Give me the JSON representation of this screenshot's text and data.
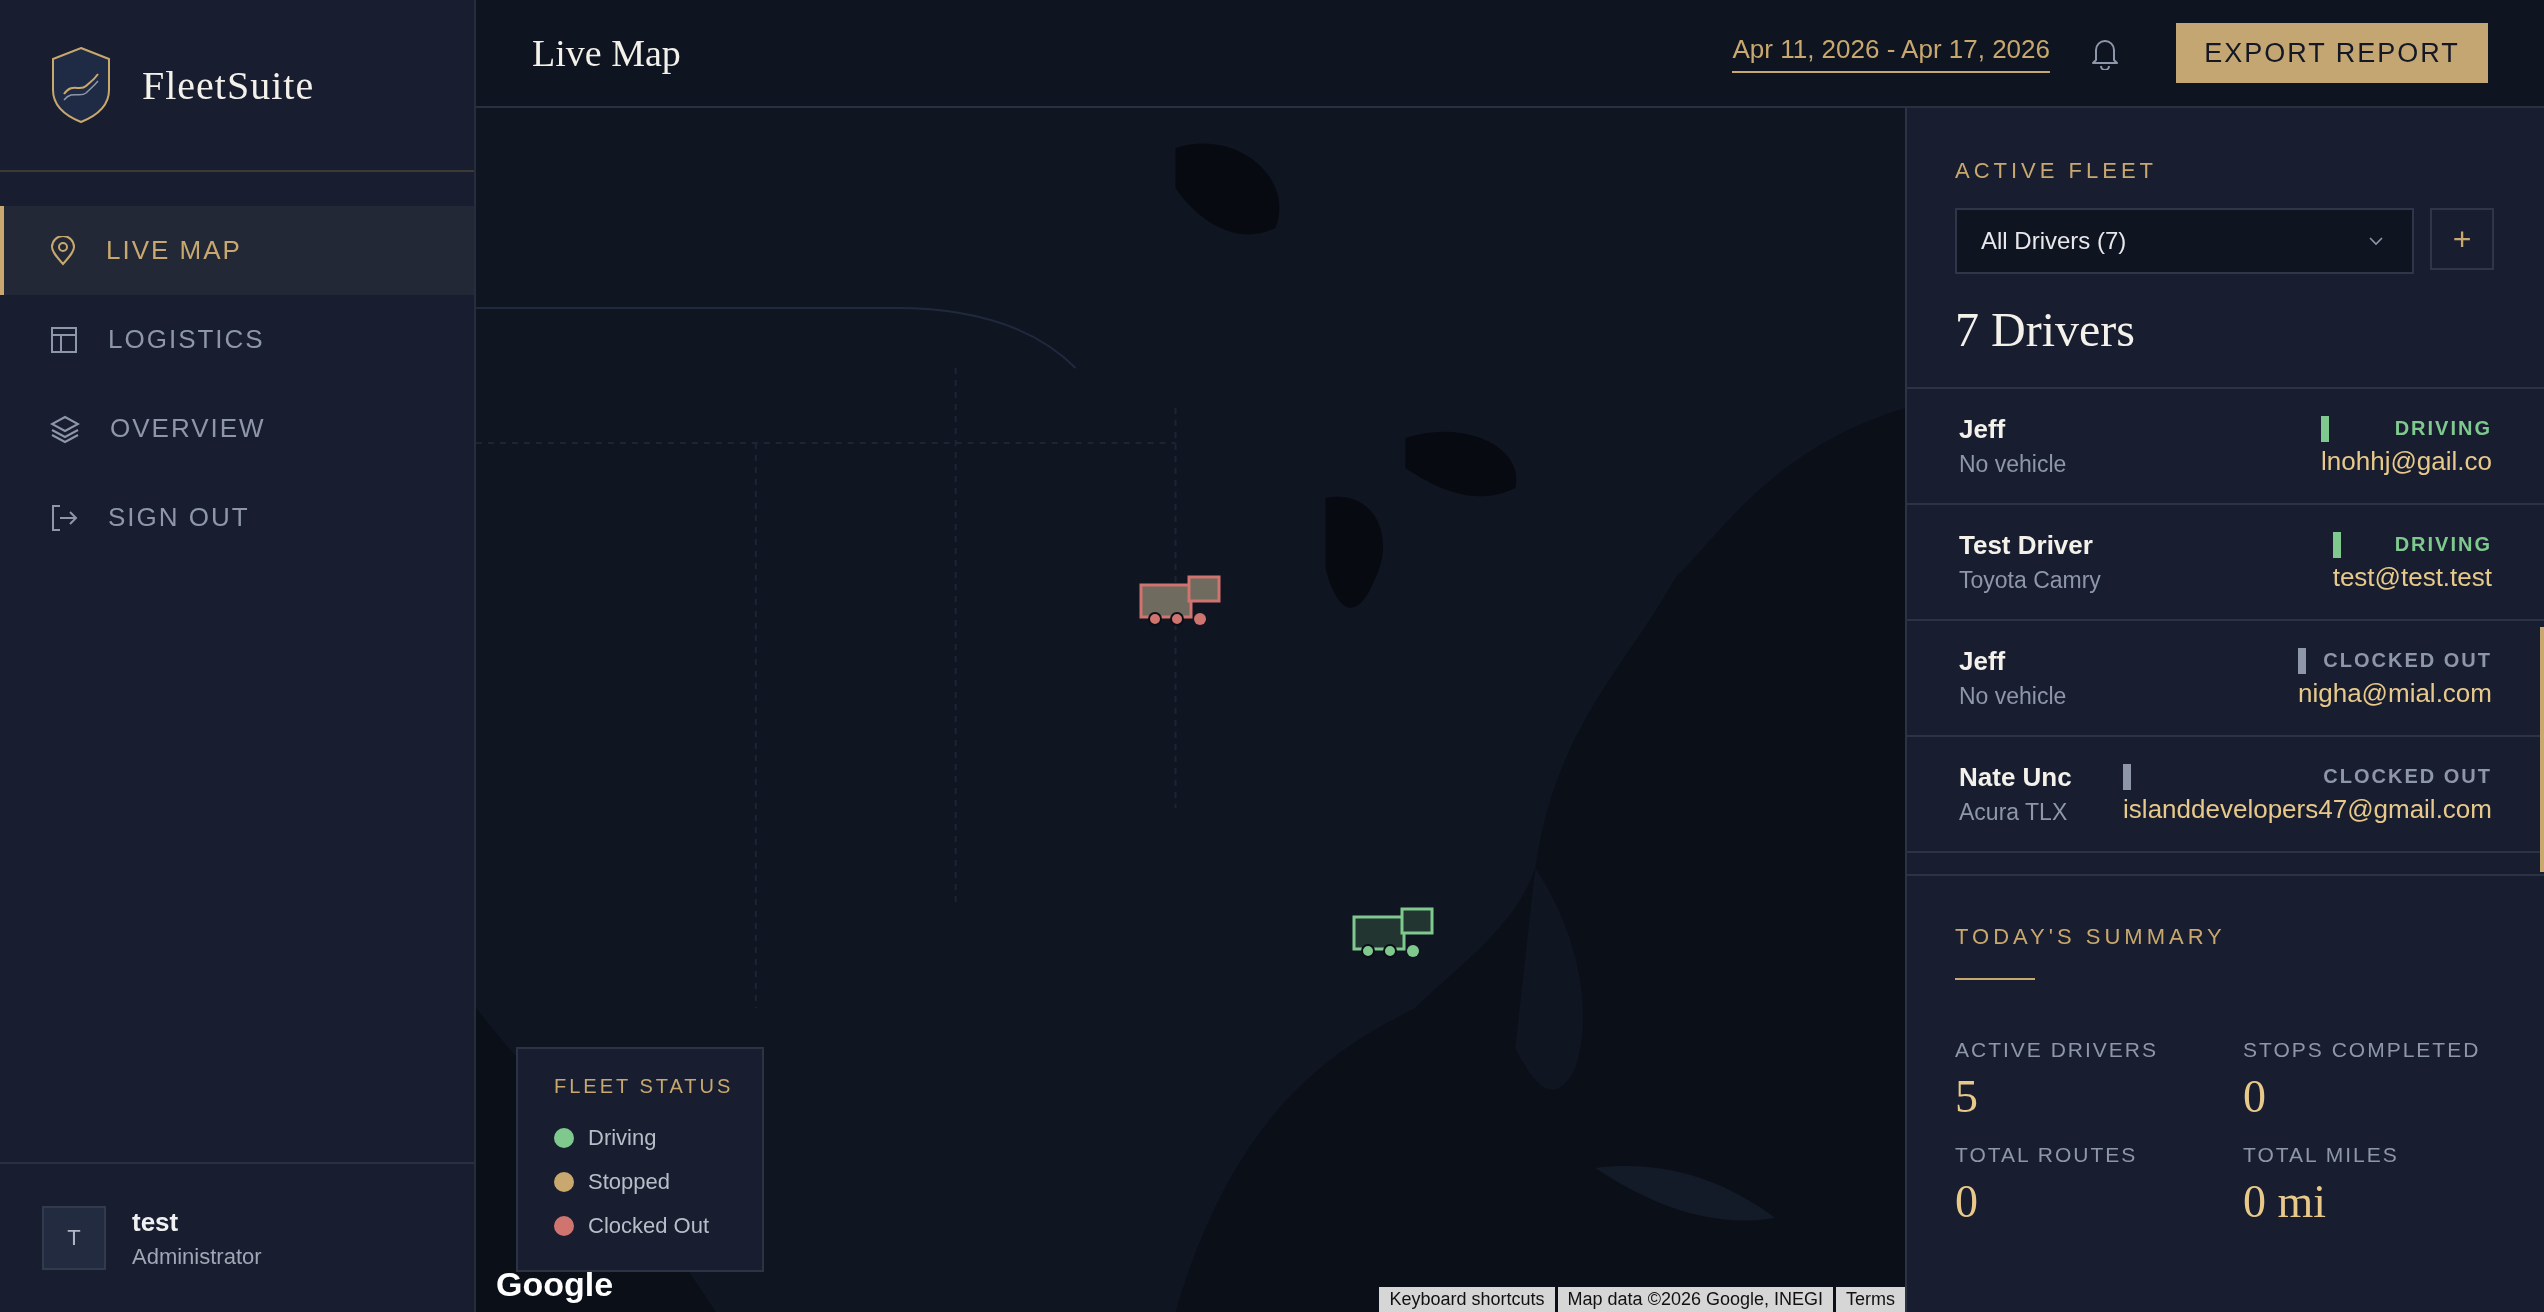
{
  "sidebar": {
    "brand": "FleetSuite",
    "nav": [
      {
        "label": "LIVE MAP",
        "selected": true
      },
      {
        "label": "LOGISTICS",
        "selected": false
      },
      {
        "label": "OVERVIEW",
        "selected": false
      },
      {
        "label": "SIGN OUT",
        "selected": false
      }
    ],
    "user": {
      "initial": "T",
      "name": "test",
      "role": "Administrator"
    }
  },
  "header": {
    "title": "Live Map",
    "date_range": "Apr 11, 2026 - Apr 17, 2026",
    "export_button": "EXPORT REPORT"
  },
  "map": {
    "markers": [
      {
        "kind": "clocked_out"
      },
      {
        "kind": "driving"
      }
    ],
    "legend": {
      "title": "FLEET STATUS",
      "items": [
        {
          "label": "Driving",
          "color": "#7fc98f"
        },
        {
          "label": "Stopped",
          "color": "#c8a86e"
        },
        {
          "label": "Clocked Out",
          "color": "#d07470"
        }
      ]
    },
    "logo": "Google",
    "attribution": [
      "Keyboard shortcuts",
      "Map data ©2026 Google, INEGI",
      "Terms"
    ]
  },
  "fleet": {
    "title": "ACTIVE FLEET",
    "filter": "All Drivers (7)",
    "add_button": "+",
    "count": "7 Drivers",
    "drivers": [
      {
        "name": "Jeff",
        "vehicle": "No vehicle",
        "status": "DRIVING",
        "kind": "driving",
        "email": "lnohhj@gail.co"
      },
      {
        "name": "Test Driver",
        "vehicle": "Toyota Camry",
        "status": "DRIVING",
        "kind": "driving",
        "email": "test@test.test"
      },
      {
        "name": "Jeff",
        "vehicle": "No vehicle",
        "status": "CLOCKED OUT",
        "kind": "clocked_out",
        "email": "nigha@mial.com"
      },
      {
        "name": "Nate Unc",
        "vehicle": "Acura TLX",
        "status": "CLOCKED OUT",
        "kind": "clocked_out",
        "email": "islanddevelopers47@gmail.com"
      }
    ]
  },
  "summary": {
    "title": "TODAY'S SUMMARY",
    "stats": [
      {
        "label": "ACTIVE DRIVERS",
        "value": "5"
      },
      {
        "label": "STOPS COMPLETED",
        "value": "0"
      },
      {
        "label": "TOTAL ROUTES",
        "value": "0"
      },
      {
        "label": "TOTAL MILES",
        "value": "0 mi"
      }
    ]
  }
}
